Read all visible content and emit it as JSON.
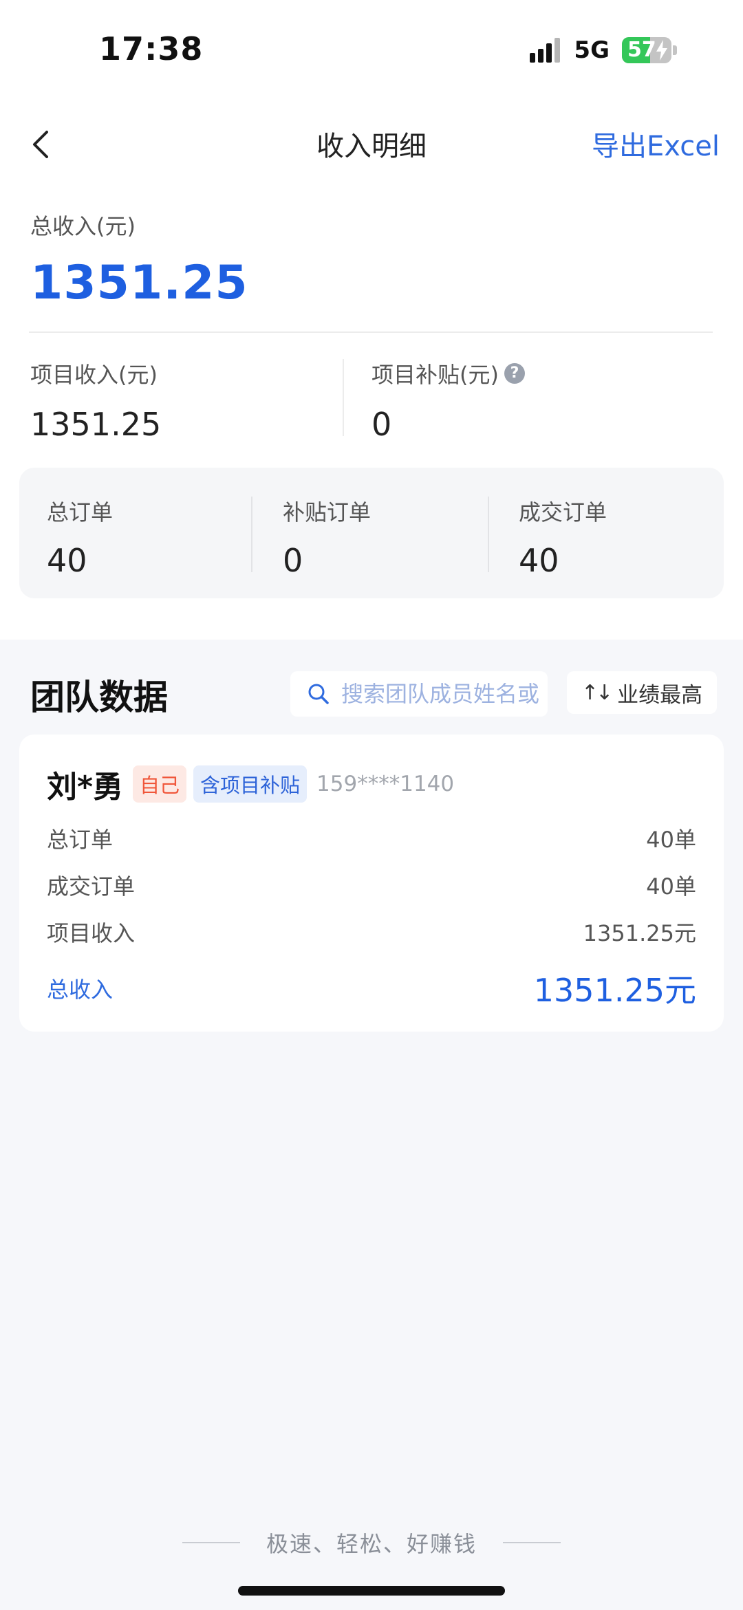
{
  "status_bar": {
    "time": "17:38",
    "network": "5G",
    "battery": "57",
    "battery_level": 57,
    "icons": [
      "signal-icon",
      "battery-icon",
      "charging-bolt-icon"
    ]
  },
  "nav": {
    "title": "收入明细",
    "export_label": "导出Excel",
    "back_icon": "chevron-left-icon"
  },
  "summary": {
    "total_label": "总收入(元)",
    "total_value": "1351.25",
    "project_income_label": "项目收入(元)",
    "project_income_value": "1351.25",
    "project_subsidy_label": "项目补贴(元)",
    "project_subsidy_value": "0",
    "help_icon_glyph": "?"
  },
  "orders": {
    "total_label": "总订单",
    "total_value": "40",
    "subsidy_label": "补贴订单",
    "subsidy_value": "0",
    "deal_label": "成交订单",
    "deal_value": "40"
  },
  "team": {
    "title": "团队数据",
    "search_placeholder": "搜索团队成员姓名或",
    "sort_label": "业绩最高",
    "sort_icon_glyph": "↑↓"
  },
  "member": {
    "name": "刘*勇",
    "tag_self": "自己",
    "tag_subsidy": "含项目补贴",
    "phone": "159****1140",
    "rows": [
      {
        "label": "总订单",
        "value": "40单"
      },
      {
        "label": "成交订单",
        "value": "40单"
      },
      {
        "label": "项目收入",
        "value": "1351.25元"
      }
    ],
    "total_label": "总收入",
    "total_value": "1351.25元"
  },
  "footer": {
    "slogan": "极速、轻松、好赚钱"
  },
  "colors": {
    "accent_blue": "#1e5fe0",
    "link_blue": "#2f6bdf",
    "tag_red": "#f0563a",
    "battery_green": "#34c759",
    "page_bg": "#f6f7fa"
  }
}
